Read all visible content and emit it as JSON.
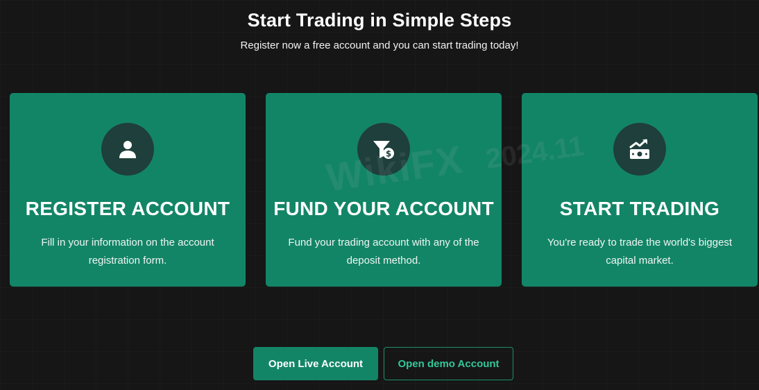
{
  "header": {
    "title": "Start Trading in Simple Steps",
    "subtitle": "Register now a free account and you can start trading today!"
  },
  "steps": [
    {
      "icon": "user-icon",
      "title": "REGISTER ACCOUNT",
      "description": "Fill in your information on the account registration form."
    },
    {
      "icon": "funnel-dollar-icon",
      "title": "FUND YOUR ACCOUNT",
      "description": "Fund your trading account with any of the deposit method."
    },
    {
      "icon": "money-chart-icon",
      "title": "START TRADING",
      "description": "You're ready to trade the world's biggest capital market."
    }
  ],
  "buttons": {
    "live_label": "Open Live Account",
    "demo_label": "Open demo Account"
  },
  "watermark": {
    "brand": "WikiFX",
    "date": "2024.11"
  },
  "colors": {
    "background": "#161616",
    "card": "#138567",
    "icon_circle": "#1e3f3b",
    "demo_text": "#33c79a"
  }
}
